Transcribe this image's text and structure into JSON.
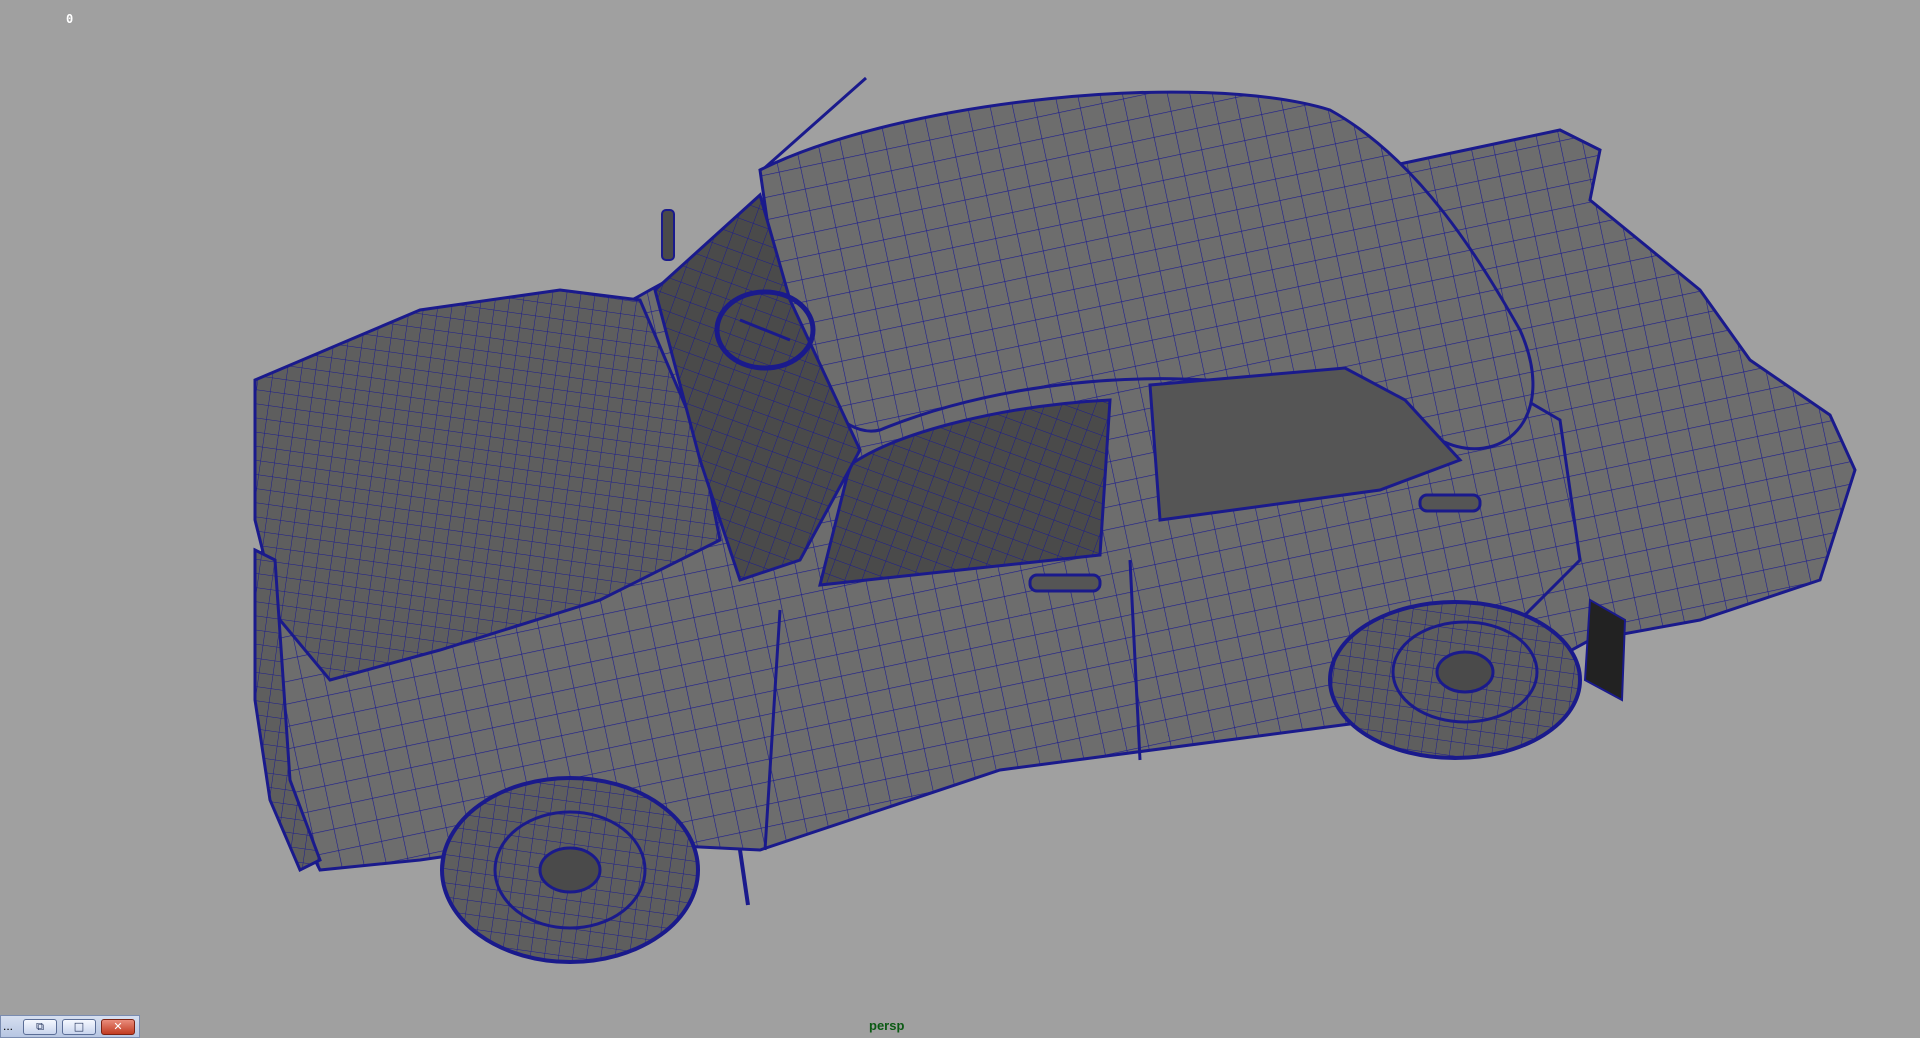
{
  "viewport": {
    "hud_counter": "0",
    "camera_name": "persp",
    "background_color": "#a0a0a0",
    "wireframe_color": "#1a1a8c",
    "model_fill_color": "#6e6e6e"
  },
  "window_controls": {
    "collapsed_label": "...",
    "restore_icon": "restore-icon",
    "maximize_icon": "maximize-icon",
    "close_icon": "close-icon",
    "restore_glyph": "⧉",
    "maximize_glyph": "□",
    "close_glyph": "✕"
  }
}
